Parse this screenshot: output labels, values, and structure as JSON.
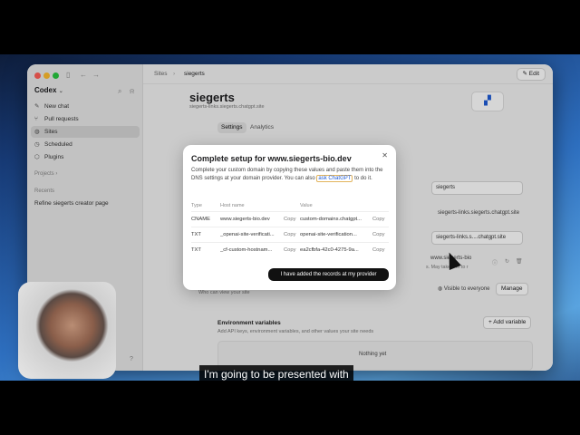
{
  "colors": {
    "accent": "#1e5bd6",
    "primary_button": "#111111",
    "highlight_border": "#e2b45d"
  },
  "sidebar": {
    "brand": "Codex",
    "items": [
      {
        "label": "New chat",
        "icon": "compose-icon"
      },
      {
        "label": "Pull requests",
        "icon": "pull-request-icon"
      },
      {
        "label": "Sites",
        "icon": "globe-icon"
      },
      {
        "label": "Scheduled",
        "icon": "clock-icon"
      },
      {
        "label": "Plugins",
        "icon": "plugin-icon"
      }
    ],
    "projects_label": "Projects",
    "recents_label": "Recents",
    "recent_item": "Refine siegerts creator page"
  },
  "topbar": {
    "crumb_root": "Sites",
    "crumb_current": "siegerts",
    "edit_label": "Edit"
  },
  "site": {
    "title": "siegerts",
    "subtitle": "siegerts-links.siegerts.chatgpt.site"
  },
  "tabs": [
    "Settings",
    "Analytics"
  ],
  "settings": {
    "name_value": "siegerts",
    "url_text": "siegerts-links.siegerts.chatgpt.site",
    "subdomain_prefix": "siegerts-links.s...",
    "subdomain_suffix": ".chatgpt.site",
    "custom_domain": "www.siegerts-bio",
    "dns_note": "s. May take 24h to r",
    "who_can_view": "Who can view your site",
    "visibility": "Visible to everyone",
    "manage_label": "Manage"
  },
  "env": {
    "title": "Environment variables",
    "description": "Add API keys, environment variables, and other values your site needs",
    "add_label": "Add variable",
    "empty": "Nothing yet"
  },
  "modal": {
    "title": "Complete setup for www.siegerts-bio.dev",
    "desc_before": "Complete your custom domain by copying these values and paste them into the DNS settings at your domain provider. You can also",
    "desc_link": "ask ChatGPT",
    "desc_after": "to do it.",
    "headers": {
      "type": "Type",
      "host": "Host name",
      "value": "Value"
    },
    "rows": [
      {
        "type": "CNAME",
        "host": "www.siegerts-bio.dev",
        "value": "custom-domains.chatgpt..."
      },
      {
        "type": "TXT",
        "host": "_openai-site-verificati...",
        "value": "openai-site-verification..."
      },
      {
        "type": "TXT",
        "host": "_cf-custom-hostnam...",
        "value": "ea2cfbfa-42c0-4275-9a..."
      }
    ],
    "copy_label": "Copy",
    "confirm_label": "I have added the records at my provider"
  },
  "caption": "I'm going to be presented with"
}
